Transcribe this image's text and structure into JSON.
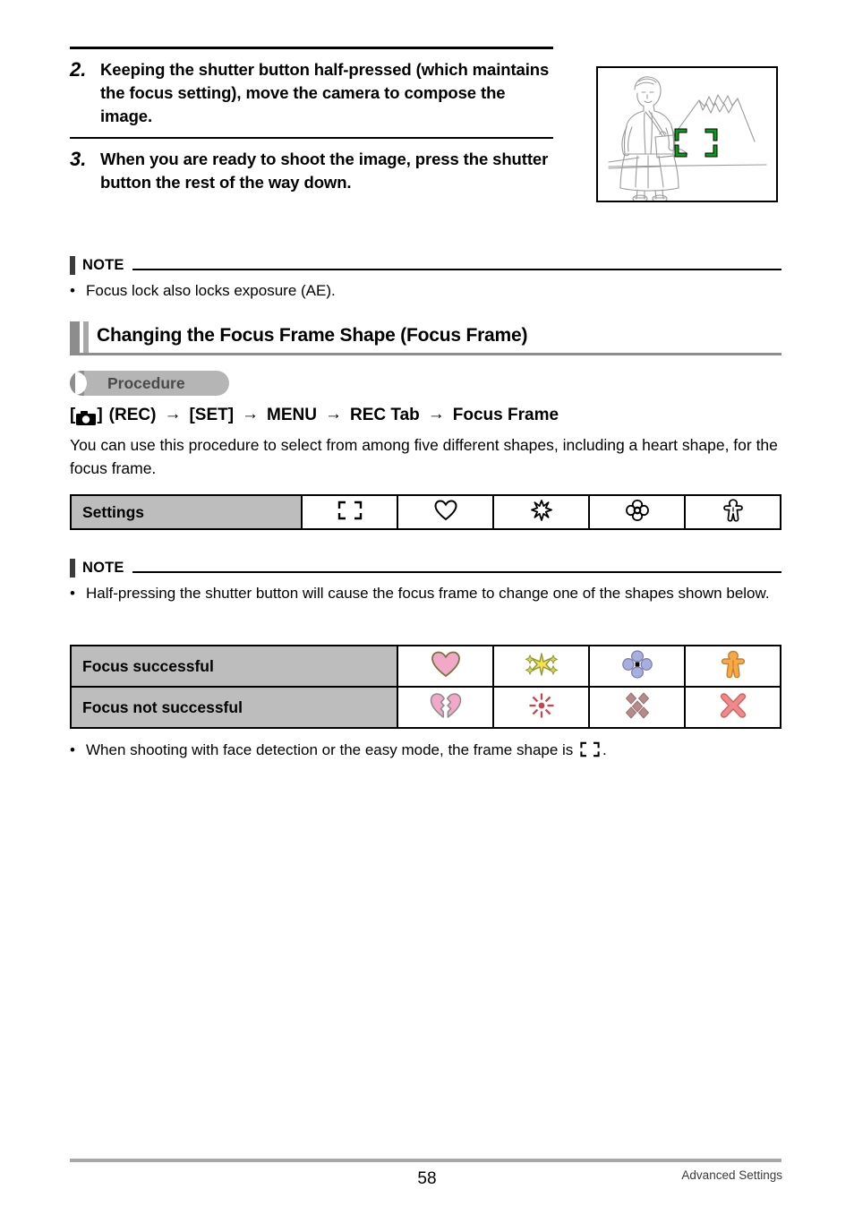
{
  "steps": [
    {
      "num": "2.",
      "text": "Keeping the shutter button half-pressed (which maintains the focus setting), move the camera to compose the image."
    },
    {
      "num": "3.",
      "text": "When you are ready to shoot the image, press the shutter button the rest of the way down."
    }
  ],
  "illustration": {
    "name": "compose-image-illustration",
    "description": "Woman holding a bag standing in front of a mountain with green focus frame brackets",
    "focus_frame_color": "#00a000"
  },
  "note1": {
    "label": "NOTE",
    "bullet": "•",
    "items": [
      "Focus lock also locks exposure (AE)."
    ]
  },
  "section": {
    "title": "Changing the Focus Frame Shape (Focus Frame)",
    "bar_color": "#8d8d8d"
  },
  "procedure_badge": {
    "label": "Procedure",
    "bg_color": "#b5b5b5",
    "tab_color": "#8d8d8d"
  },
  "procedure_path": {
    "camera_bracket_open": "[",
    "camera_bracket_close": "]",
    "rec_label": "(REC)",
    "arrow": "→",
    "steps": [
      "[SET]",
      "MENU",
      "REC Tab",
      "Focus Frame"
    ]
  },
  "intro_paragraph": "You can use this procedure to select from among five different shapes, including a heart shape, for the focus frame.",
  "settings_table": {
    "row_label": "Settings",
    "icons": [
      "bracket-frame-icon",
      "heart-outline-icon",
      "sparkle-outline-icon",
      "flower-outline-icon",
      "figure-outline-icon"
    ]
  },
  "note2": {
    "label": "NOTE",
    "bullet": "•",
    "items": [
      "Half-pressing the shutter button will cause the focus frame to change one of the shapes shown below."
    ]
  },
  "shapes_table": {
    "rows": [
      {
        "label": "Focus successful",
        "icons": [
          "heart-pink-icon",
          "sparkle-yellow-icon",
          "flower-purple-icon",
          "figure-orange-icon"
        ]
      },
      {
        "label": "Focus not successful",
        "icons": [
          "broken-heart-pink-icon",
          "burst-red-icon",
          "scattered-diamonds-icon",
          "cross-red-icon"
        ]
      }
    ],
    "colors": {
      "heart_pink": "#f2a8c8",
      "heart_outline": "#7a7340",
      "sparkle_yellow": "#f2e24e",
      "sparkle_accent": "#9aa83a",
      "flower_purple": "#a9aee0",
      "figure_orange": "#f5a948",
      "burst_red": "#c2484e",
      "diamond_mauve": "#b58a8a",
      "cross_red": "#ef8a8a"
    }
  },
  "closing_note": {
    "bullet": "•",
    "text_before": "When shooting with face detection or the easy mode, the frame shape is",
    "text_after": "."
  },
  "footer": {
    "page_number": "58",
    "section_name": "Advanced Settings"
  }
}
